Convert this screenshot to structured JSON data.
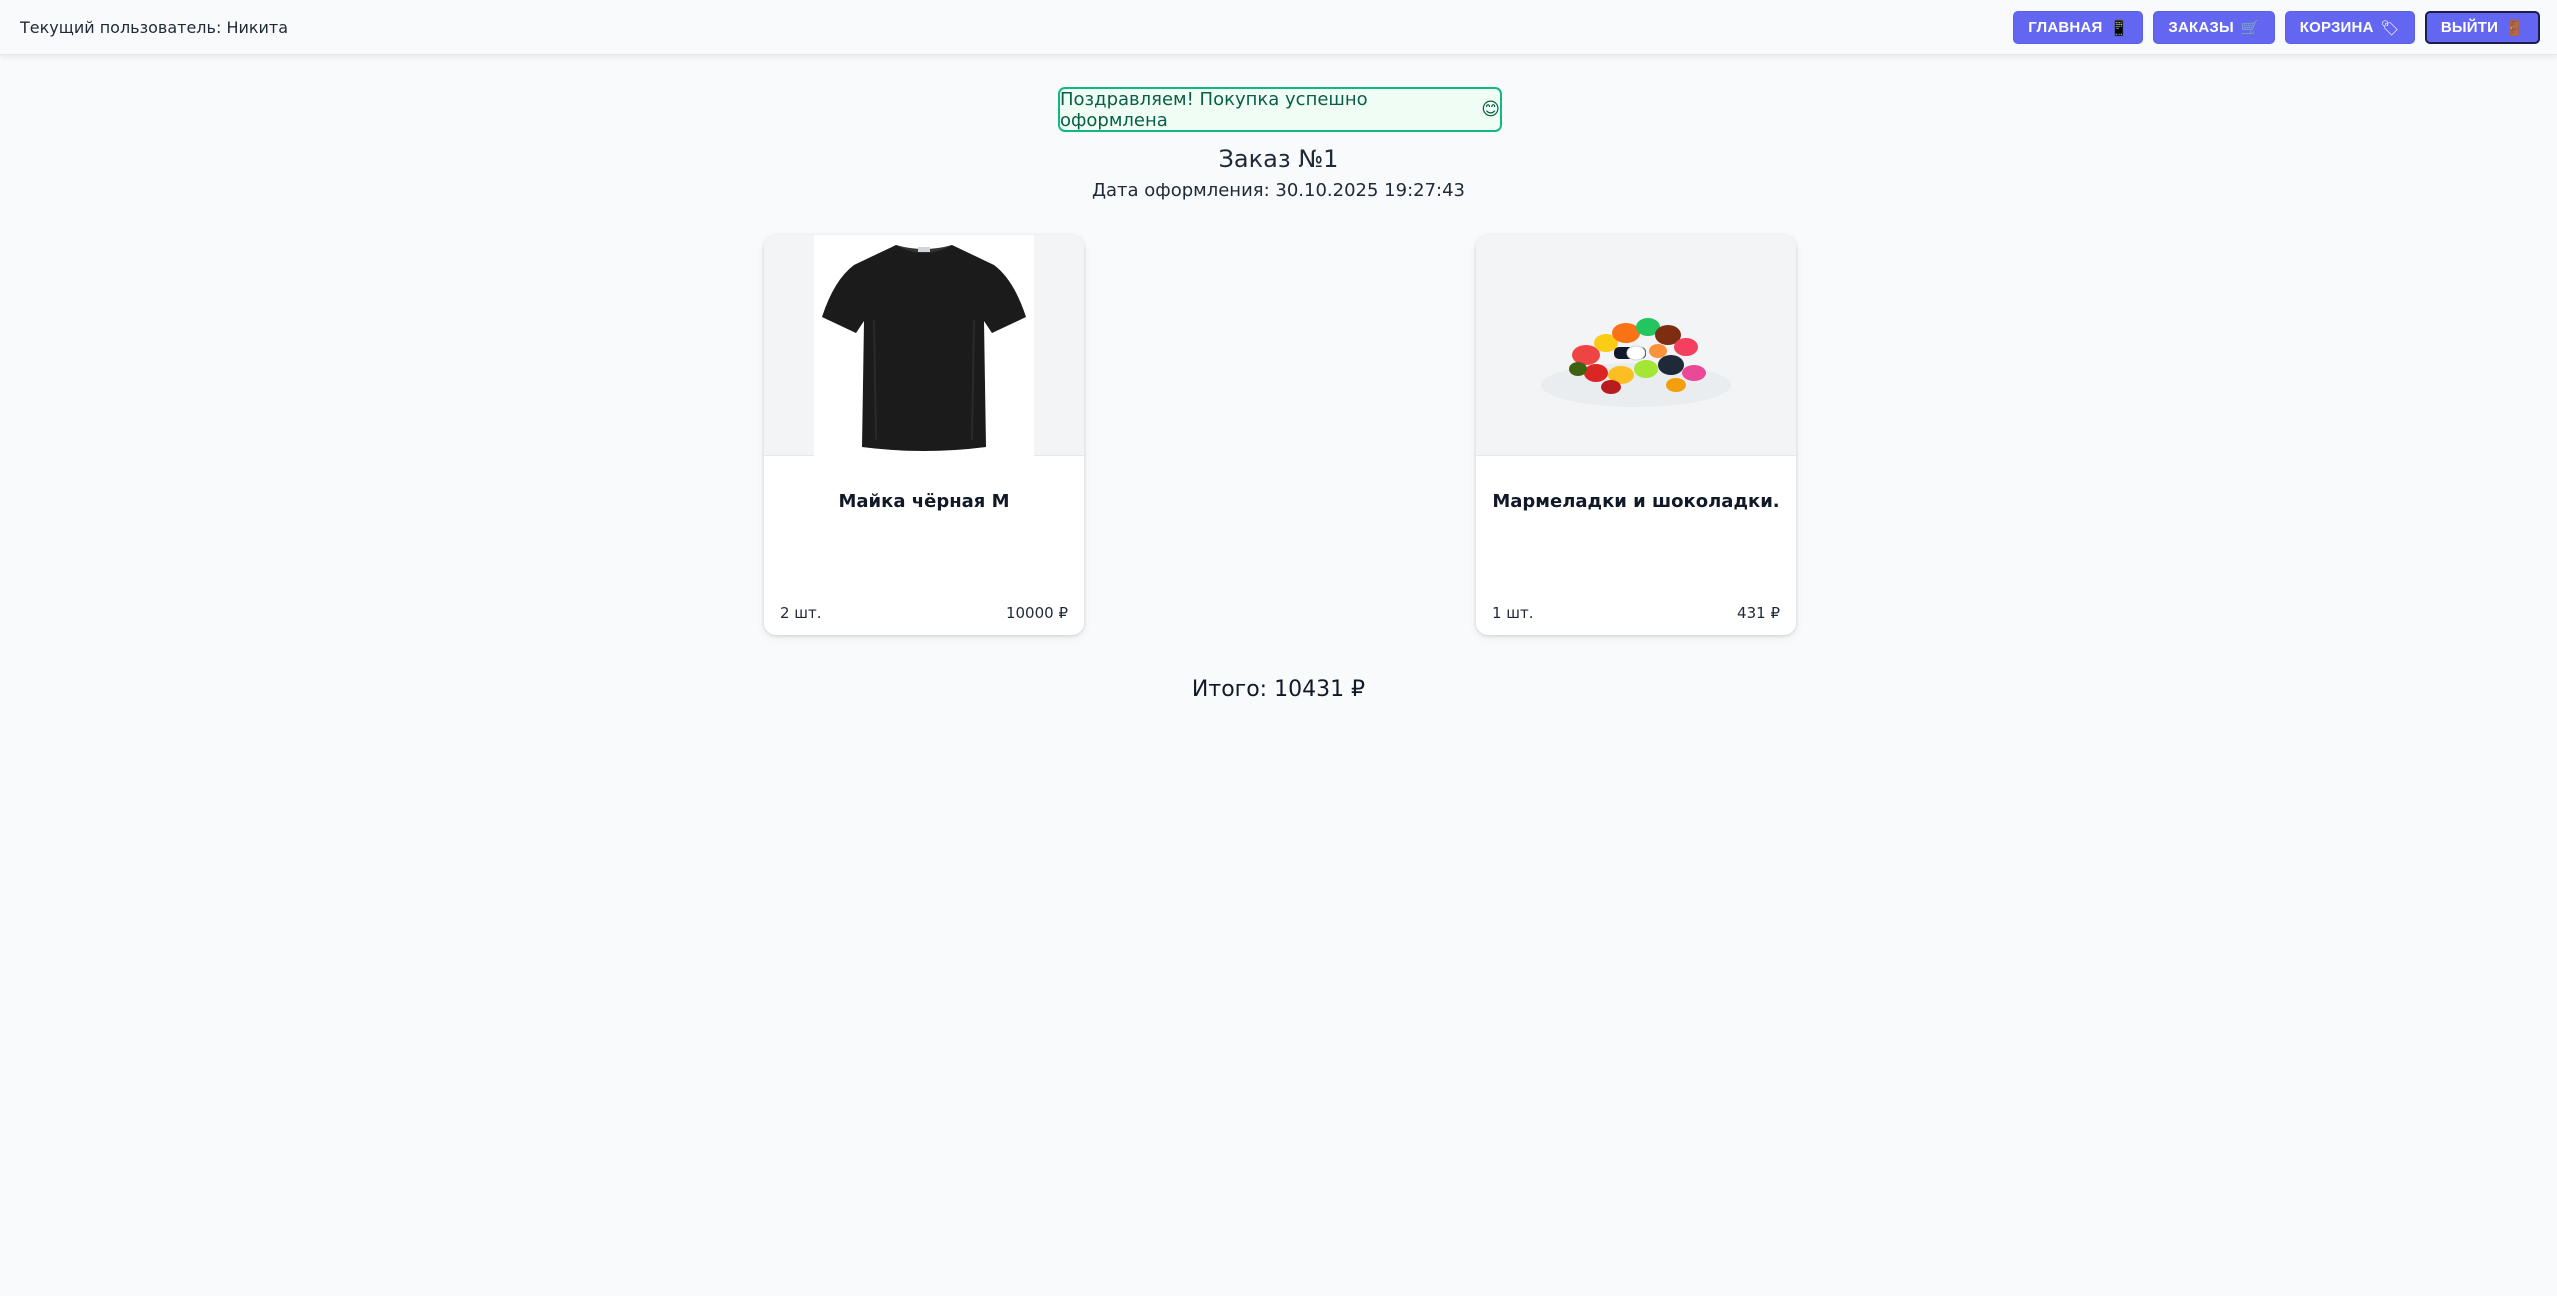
{
  "header": {
    "user_label": "Текущий пользователь: Никита",
    "nav": [
      {
        "label": "ГЛАВНАЯ",
        "icon": "📱"
      },
      {
        "label": "ЗАКАЗЫ",
        "icon": "🛒"
      },
      {
        "label": "КОРЗИНА",
        "icon": "🏷"
      },
      {
        "label": "ВЫЙТИ",
        "icon": "🚪"
      }
    ]
  },
  "alert": {
    "text": "Поздравляем! Покупка успешно оформлена",
    "emoji": "😊"
  },
  "order": {
    "title": "Заказ №1",
    "date": "Дата оформления: 30.10.2025 19:27:43",
    "items": [
      {
        "name": "Майка чёрная M",
        "qty": "2 шт.",
        "price": "10000 ₽",
        "image": "black-tshirt"
      },
      {
        "name": "Мармеладки и шоколадки.",
        "qty": "1 шт.",
        "price": "431 ₽",
        "image": "candy-pile"
      }
    ],
    "total": "Итого: 10431 ₽"
  },
  "colors": {
    "accent": "#6366f1",
    "success_border": "#10b981",
    "success_text": "#065f46",
    "background": "#f8fafc"
  }
}
